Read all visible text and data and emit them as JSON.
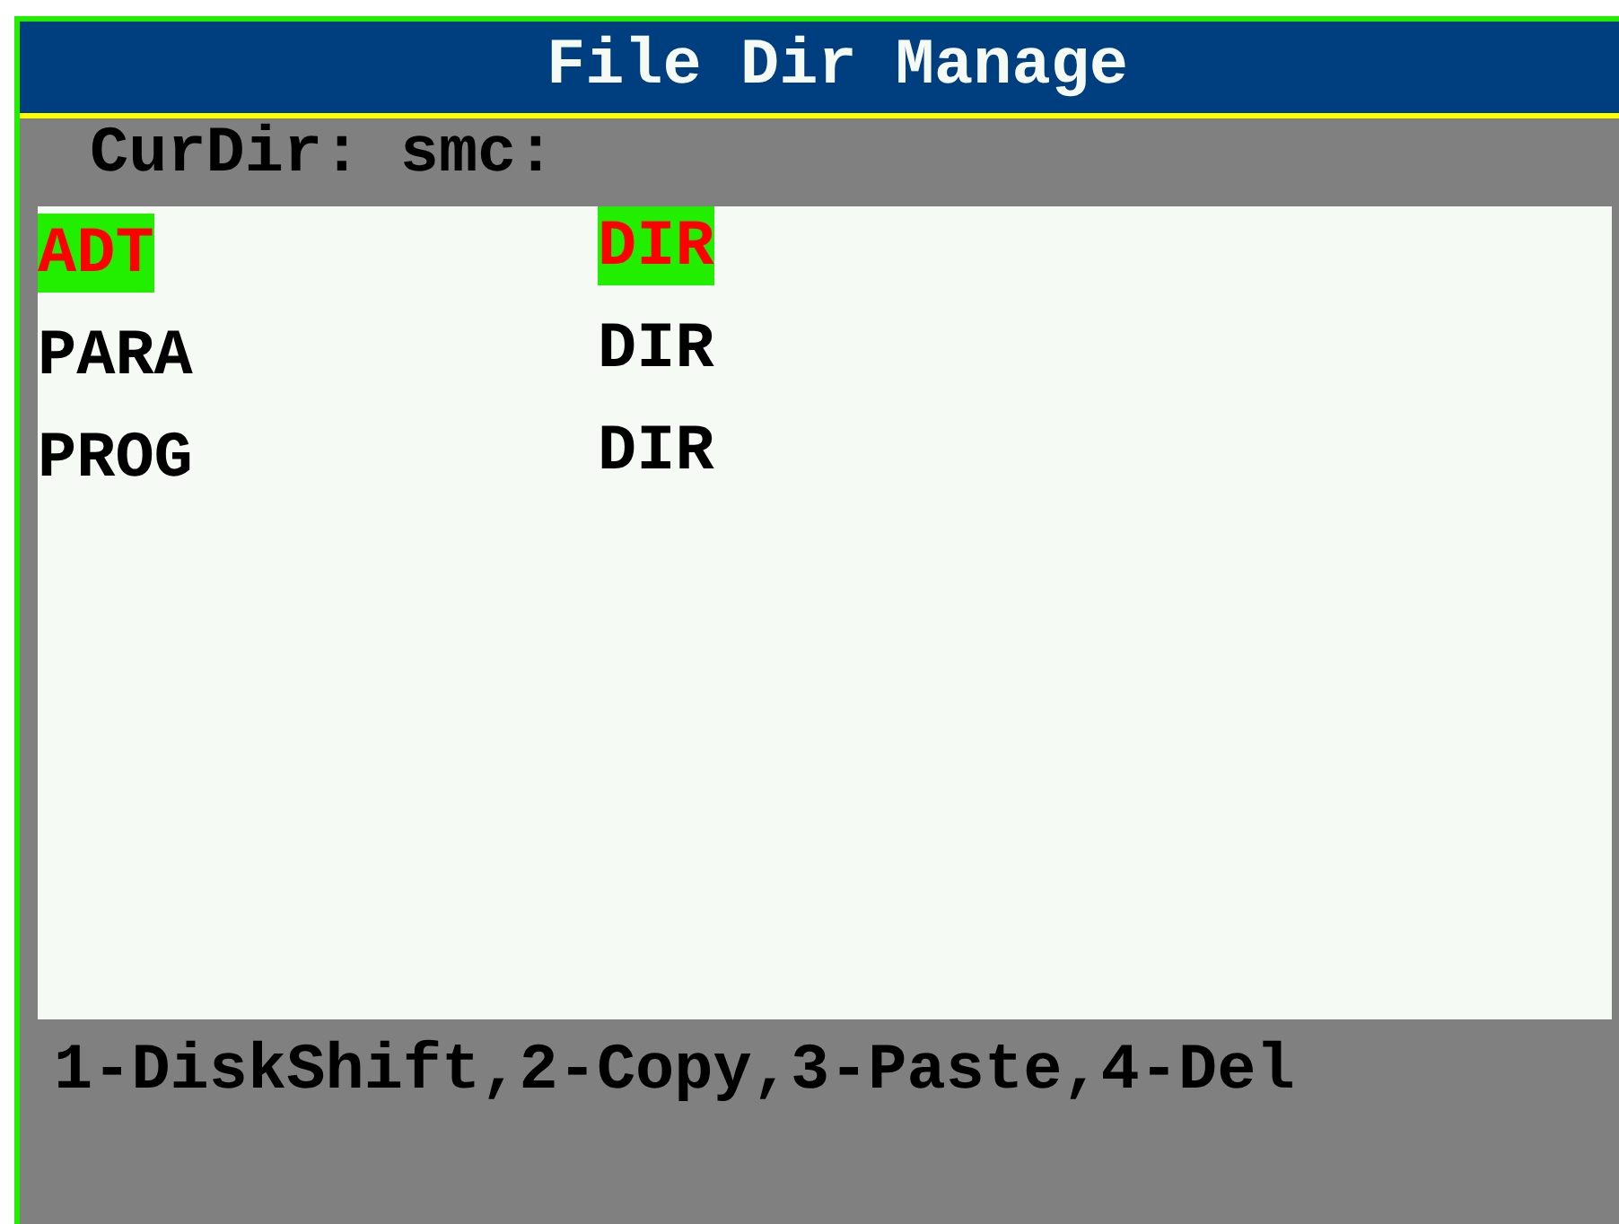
{
  "window": {
    "title": "File Dir Manage"
  },
  "current_dir": {
    "label": "CurDir:",
    "value": "smc:"
  },
  "files": [
    {
      "name": "ADT",
      "type": "DIR",
      "selected": true
    },
    {
      "name": "PARA",
      "type": "DIR",
      "selected": false
    },
    {
      "name": "PROG",
      "type": "DIR",
      "selected": false
    }
  ],
  "status_bar": "1-DiskShift,2-Copy,3-Paste,4-Del"
}
